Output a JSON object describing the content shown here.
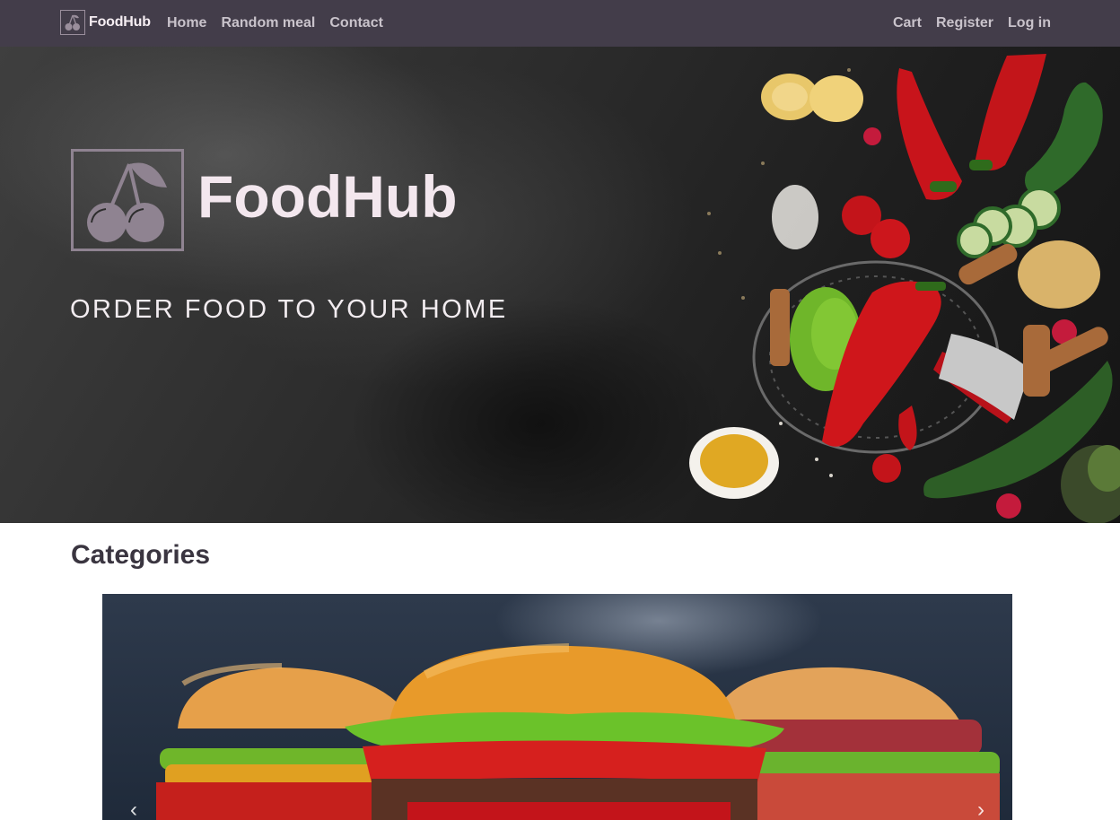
{
  "navbar": {
    "brand": "FoodHub",
    "left_links": [
      {
        "label": "Home"
      },
      {
        "label": "Random meal"
      },
      {
        "label": "Contact"
      }
    ],
    "right_links": [
      {
        "label": "Cart"
      },
      {
        "label": "Register"
      },
      {
        "label": "Log in"
      }
    ]
  },
  "hero": {
    "brand": "FoodHub",
    "tagline": "ORDER FOOD TO YOUR HOME",
    "logo_icon": "cherry-icon"
  },
  "categories": {
    "title": "Categories"
  },
  "icons": {
    "brand_logo": "cherry-icon",
    "carousel_prev": "chevron-left-icon",
    "carousel_next": "chevron-right-icon"
  },
  "colors": {
    "navbar_bg": "#433d4a",
    "brand_text": "#f6eef3",
    "nav_link": "#c9c3cb",
    "heading": "#3a3540"
  }
}
